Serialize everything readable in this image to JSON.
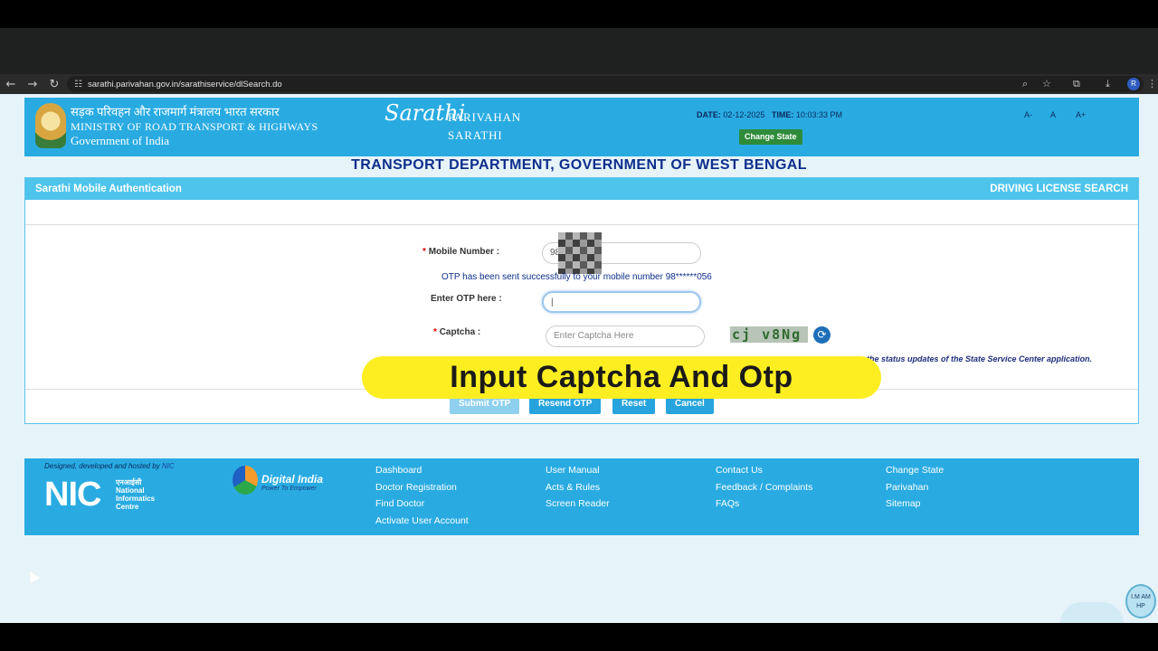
{
  "browser": {
    "url": "sarathi.parivahan.gov.in/sarathiservice/dlSearch.do",
    "avatar_letter": "R"
  },
  "header": {
    "ministry_hindi": "सड़क परिवहन और राजमार्ग मंत्रालय भारत सरकार",
    "ministry_en": "MINISTRY OF ROAD TRANSPORT & HIGHWAYS",
    "government": "Government of India",
    "logo_text": "Sarathi",
    "brand_line1": "PARIVAHAN",
    "brand_line2": "SARATHI",
    "date_label": "DATE:",
    "date_value": "02-12-2025",
    "time_label": "TIME:",
    "time_value": "10:03:33 PM",
    "change_state": "Change State",
    "font_small": "A-",
    "font_normal": "A",
    "font_large": "A+"
  },
  "dept_title": "TRANSPORT DEPARTMENT, GOVERNMENT OF WEST BENGAL",
  "panel": {
    "left_title": "Sarathi Mobile Authentication",
    "right_title": "DRIVING LICENSE SEARCH",
    "mobile_label": "Mobile Number",
    "mobile_value": "98",
    "otp_message": "OTP has been sent successfully to your mobile number 98******056",
    "otp_label": "Enter OTP here",
    "otp_value": "|",
    "captcha_label": "Captcha",
    "captcha_placeholder": "Enter Captcha Here",
    "captcha_text": "cj v8Ng",
    "note": "the status updates of the State Service Center application.",
    "buttons": {
      "submit": "Submit OTP",
      "resend": "Resend OTP",
      "reset": "Reset",
      "cancel": "Cancel"
    }
  },
  "overlay_caption": "Input Captcha And Otp",
  "footer": {
    "designed_by": "Designed, developed and hosted by",
    "designed_org": "NIC",
    "nic_logo": "NIC",
    "nic_lines": [
      "एनआईसी",
      "National",
      "Informatics",
      "Centre"
    ],
    "digital_india": "Digital India",
    "digital_india_sub": "Power To Empower",
    "col1": [
      "Dashboard",
      "Doctor Registration",
      "Find Doctor",
      "Activate User Account"
    ],
    "col2": [
      "User Manual",
      "Acts & Rules",
      "Screen Reader"
    ],
    "col3": [
      "Contact Us",
      "Feedback / Complaints",
      "FAQs"
    ],
    "col4": [
      "Change State",
      "Parivahan",
      "Sitemap"
    ]
  },
  "chatbot_text": "I.M AM HP"
}
